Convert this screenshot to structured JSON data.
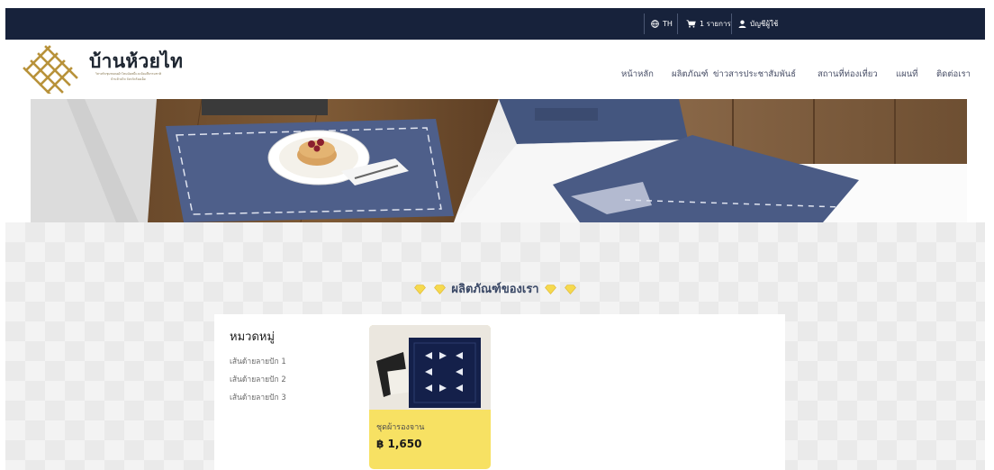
{
  "topbar": {
    "language": "TH",
    "cart": "1 รายการ",
    "account": "บัญชีผู้ใช้"
  },
  "brand": {
    "name": "บ้านห้วยไท",
    "subtitle_line1": "วิสาหกิจชุมชนทอผ้าไหมมัดหมี่และย้อมสีธรรมชาติ",
    "subtitle_line2": "บ้านห้วยไท จังหวัดร้อยเอ็ด"
  },
  "nav": {
    "items": [
      {
        "label": "หน้าหลัก"
      },
      {
        "label": "ผลิตภัณฑ์"
      },
      {
        "label": "ข่าวสารประชาสัมพันธ์"
      },
      {
        "label": "สถานที่ท่องเที่ยว"
      },
      {
        "label": "แผนที่"
      },
      {
        "label": "ติดต่อเรา"
      }
    ]
  },
  "products_section": {
    "title": "ผลิตภัณฑ์ของเรา"
  },
  "categories": {
    "title": "หมวดหมู่",
    "items": [
      {
        "label": "เส้นด้ายลายปัก 1"
      },
      {
        "label": "เส้นด้ายลายปัก 2"
      },
      {
        "label": "เส้นด้ายลายปัก 3"
      }
    ]
  },
  "products": [
    {
      "name": "ชุดผ้ารองจาน",
      "price": "฿ 1,650"
    }
  ],
  "colors": {
    "topbar": "#17223b",
    "card": "#f7e163",
    "gem": "#f5d94e",
    "logo_gold": "#b8923a"
  }
}
